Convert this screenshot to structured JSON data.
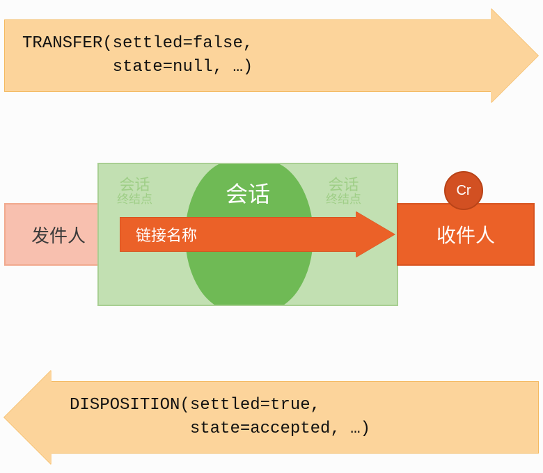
{
  "top_arrow": {
    "line1": "TRANSFER(settled=false,",
    "line2": "         state=null, …)"
  },
  "bottom_arrow": {
    "line1": "DISPOSITION(settled=true,",
    "line2": "            state=accepted, …)"
  },
  "sender_label": "发件人",
  "receiver_label": "收件人",
  "session": {
    "title": "会话",
    "endpoint_line1": "会话",
    "endpoint_line2": "终结点"
  },
  "link_label": "链接名称",
  "badge": "Cr",
  "colors": {
    "arrow_fill": "#fcd49b",
    "arrow_border": "#f4b960",
    "session_outer": "#c2e0b2",
    "session_inner": "#6fba55",
    "sender_fill": "#f8c0af",
    "receiver_fill": "#eb6128",
    "badge_fill": "#d25022"
  }
}
